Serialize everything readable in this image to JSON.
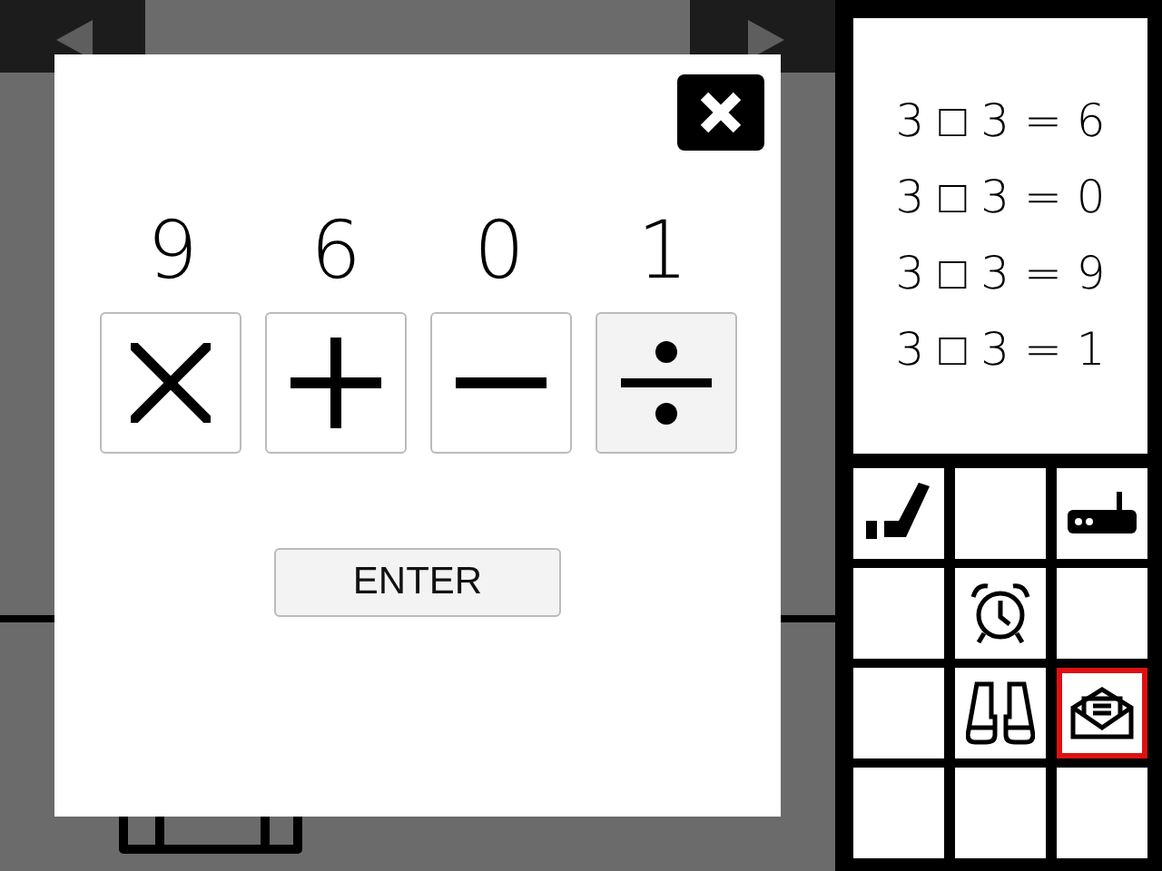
{
  "scene": {
    "arrows": [
      {
        "kind": "left"
      },
      {
        "kind": "right"
      }
    ]
  },
  "dialog": {
    "numbers": [
      "9",
      "6",
      "0",
      "1"
    ],
    "operators": [
      {
        "kind": "multiply",
        "selected": false
      },
      {
        "kind": "add",
        "selected": false
      },
      {
        "kind": "subtract",
        "selected": false
      },
      {
        "kind": "divide",
        "selected": true
      }
    ],
    "enter": "ENTER"
  },
  "clues": [
    "3 □ 3 = 6",
    "3 □ 3 = 0",
    "3 □ 3 = 9",
    "3 □ 3 = 1"
  ],
  "inventory": [
    {
      "kind": "hockey-stick",
      "selected": false
    },
    {
      "kind": "empty",
      "selected": false
    },
    {
      "kind": "router",
      "selected": false
    },
    {
      "kind": "empty",
      "selected": false
    },
    {
      "kind": "alarm-clock",
      "selected": false
    },
    {
      "kind": "empty",
      "selected": false
    },
    {
      "kind": "empty",
      "selected": false
    },
    {
      "kind": "binoculars",
      "selected": false
    },
    {
      "kind": "envelope",
      "selected": true
    },
    {
      "kind": "empty",
      "selected": false
    },
    {
      "kind": "empty",
      "selected": false
    },
    {
      "kind": "empty",
      "selected": false
    }
  ]
}
